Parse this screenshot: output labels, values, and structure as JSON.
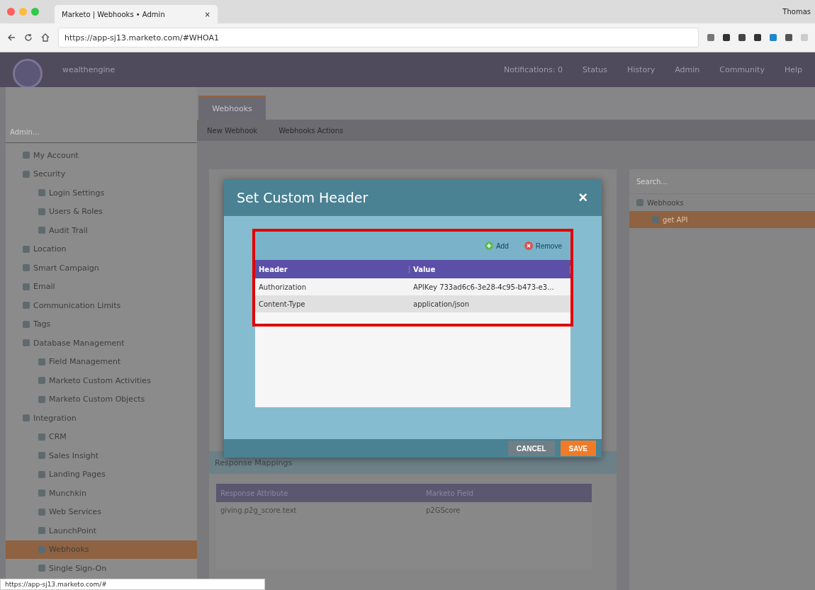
{
  "browser": {
    "tab_title": "Marketo | Webhooks • Admin",
    "tab_close": "×",
    "user": "Thomas",
    "url": "https://app-sj13.marketo.com/#WHOA1"
  },
  "app_header": {
    "workspace": "wealthengine",
    "nav": [
      "Notifications: 0",
      "Status",
      "History",
      "Admin",
      "Community",
      "Help"
    ]
  },
  "sidebar": {
    "placeholder": "Admin...",
    "items": [
      {
        "label": "My Account",
        "selected": false
      },
      {
        "label": "Security",
        "selected": false,
        "children": [
          {
            "label": "Login Settings",
            "selected": false
          },
          {
            "label": "Users & Roles",
            "selected": false
          },
          {
            "label": "Audit Trail",
            "selected": false
          }
        ]
      },
      {
        "label": "Location",
        "selected": false
      },
      {
        "label": "Smart Campaign",
        "selected": false
      },
      {
        "label": "Email",
        "selected": false
      },
      {
        "label": "Communication Limits",
        "selected": false
      },
      {
        "label": "Tags",
        "selected": false
      },
      {
        "label": "Database Management",
        "selected": false,
        "children": [
          {
            "label": "Field Management",
            "selected": false
          },
          {
            "label": "Marketo Custom Activities",
            "selected": false
          },
          {
            "label": "Marketo Custom Objects",
            "selected": false
          }
        ]
      },
      {
        "label": "Integration",
        "selected": false,
        "children": [
          {
            "label": "CRM",
            "selected": false
          },
          {
            "label": "Sales Insight",
            "selected": false
          },
          {
            "label": "Landing Pages",
            "selected": false
          },
          {
            "label": "Munchkin",
            "selected": false
          },
          {
            "label": "Web Services",
            "selected": false
          },
          {
            "label": "LaunchPoint",
            "selected": false
          },
          {
            "label": "Webhooks",
            "selected": true
          },
          {
            "label": "Single Sign-On",
            "selected": false
          }
        ]
      }
    ]
  },
  "tabs": [
    {
      "label": "Webhooks",
      "selected": true
    }
  ],
  "toolbar": [
    "New Webhook",
    "Webhooks Actions"
  ],
  "response_mappings": {
    "title": "Response Mappings",
    "columns": [
      "Response Attribute",
      "Marketo Field"
    ],
    "rows": [
      [
        "giving.p2g_score.text",
        "p2GScore"
      ]
    ]
  },
  "right_panel": {
    "placeholder": "Search...",
    "tree": [
      {
        "label": "Webhooks",
        "selected": false,
        "children": [
          {
            "label": "get API",
            "selected": true
          }
        ]
      }
    ]
  },
  "dialog": {
    "title": "Set Custom Header",
    "close": "×",
    "actions": [
      "Add",
      "Remove"
    ],
    "columns": [
      "Header",
      "Value"
    ],
    "rows": [
      {
        "cells": [
          "Authorization",
          "APIKey 733ad6c6-3e28-4c95-b473-e3..."
        ],
        "selected": false
      },
      {
        "cells": [
          "Content-Type",
          "application/json"
        ],
        "selected": true
      }
    ],
    "buttons": [
      {
        "label": "CANCEL",
        "kind": "secondary"
      },
      {
        "label": "SAVE",
        "kind": "primary"
      }
    ]
  },
  "status_link": "https://app-sj13.marketo.com/#"
}
